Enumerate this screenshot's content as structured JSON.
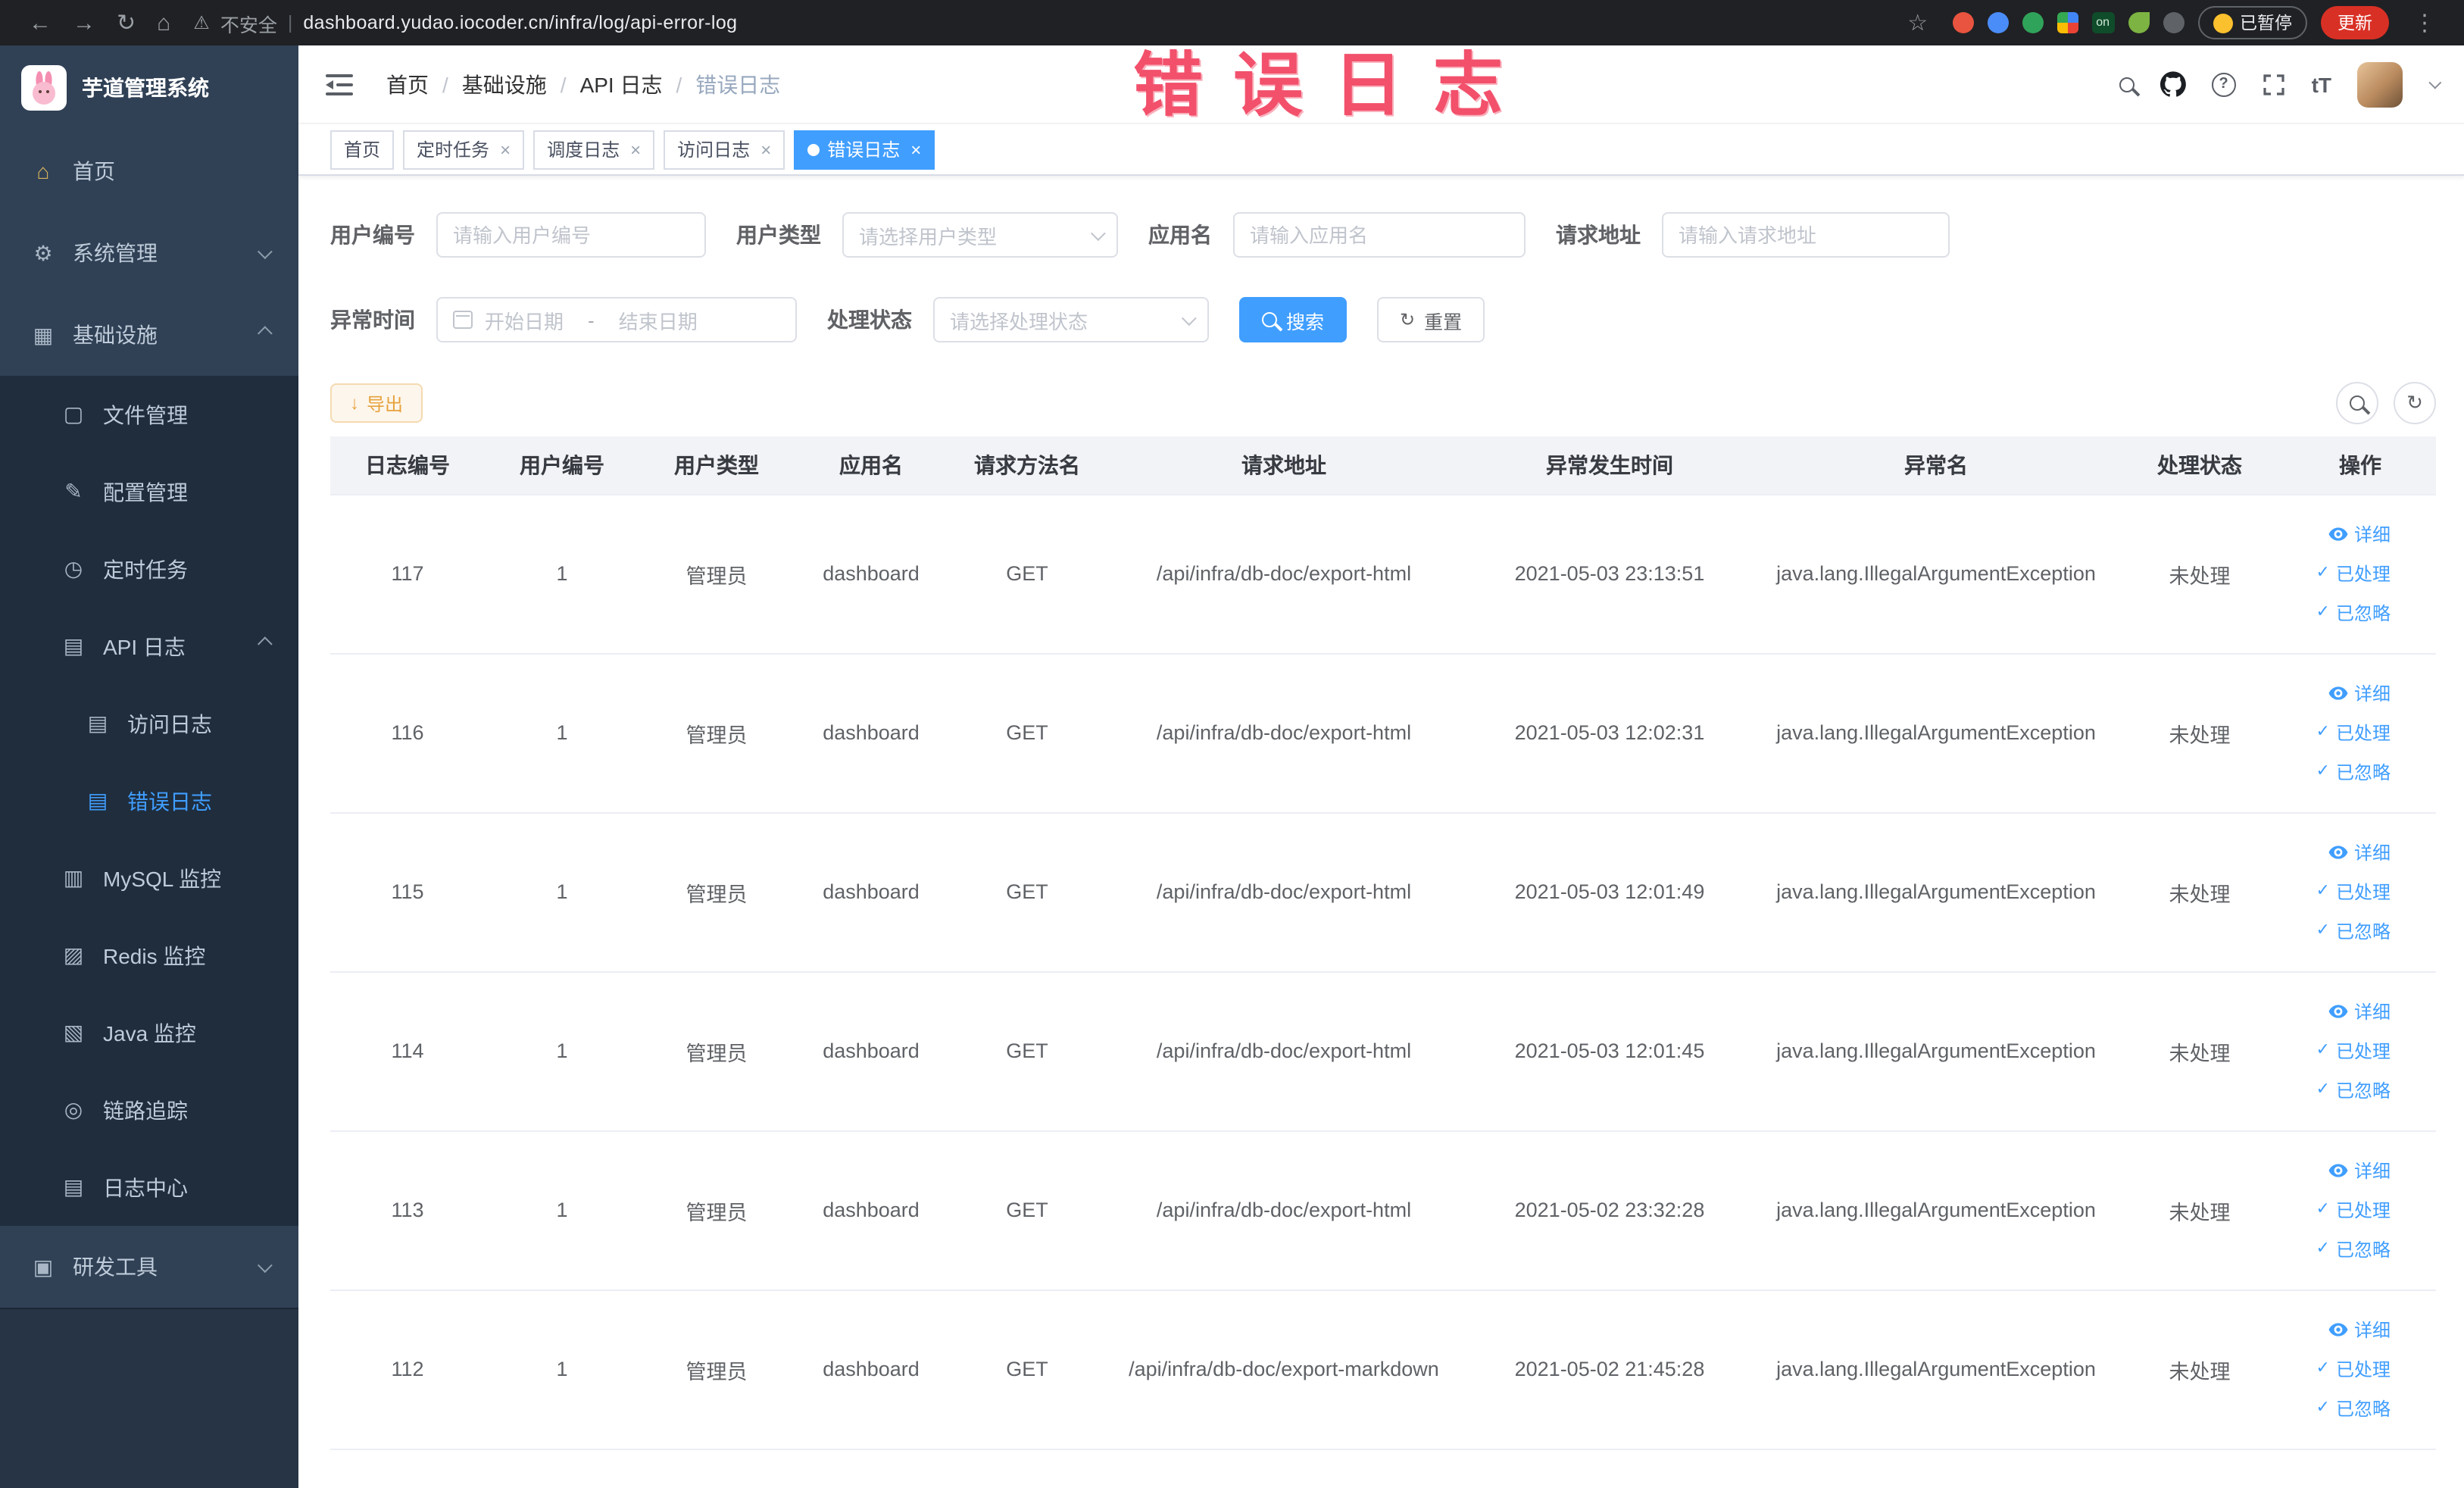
{
  "browser": {
    "security_label": "不安全",
    "url": "dashboard.yudao.iocoder.cn/infra/log/api-error-log",
    "on_badge": "on",
    "paused_badge": "已暂停",
    "update_label": "更新"
  },
  "glyphs": {
    "back": "←",
    "forward": "→",
    "reload": "↻",
    "home": "⌂",
    "warning": "⚠",
    "pipe": "|",
    "star": "☆",
    "kebab": "⋮",
    "menu_home": "⌂",
    "menu_gear": "⚙",
    "menu_infra": "▦",
    "menu_file": "▢",
    "menu_config": "✎",
    "menu_timer": "◷",
    "menu_apilog": "▤",
    "menu_accesslog": "▤",
    "menu_errorlog": "▤",
    "menu_mysql": "▥",
    "menu_redis": "▨",
    "menu_java": "▧",
    "menu_trace": "◎",
    "menu_logcenter": "▤",
    "menu_tools": "▣",
    "check": "✓",
    "download": "↓",
    "refresh": "↻",
    "close": "×",
    "question": "?",
    "font_size": "tT"
  },
  "annotation": {
    "text": "错误日志",
    "color": "#f2506b"
  },
  "sidebar": {
    "logo_title": "芋道管理系统",
    "items": [
      {
        "label": "首页"
      },
      {
        "label": "系统管理"
      },
      {
        "label": "基础设施"
      },
      {
        "label": "文件管理"
      },
      {
        "label": "配置管理"
      },
      {
        "label": "定时任务"
      },
      {
        "label": "API 日志"
      },
      {
        "label": "访问日志"
      },
      {
        "label": "错误日志"
      },
      {
        "label": "MySQL 监控"
      },
      {
        "label": "Redis 监控"
      },
      {
        "label": "Java 监控"
      },
      {
        "label": "链路追踪"
      },
      {
        "label": "日志中心"
      },
      {
        "label": "研发工具"
      }
    ]
  },
  "header": {
    "breadcrumb": [
      "首页",
      "基础设施",
      "API 日志",
      "错误日志"
    ],
    "breadcrumb_sep": "/"
  },
  "tags": [
    {
      "label": "首页"
    },
    {
      "label": "定时任务"
    },
    {
      "label": "调度日志"
    },
    {
      "label": "访问日志"
    },
    {
      "label": "错误日志"
    }
  ],
  "filters": {
    "user_id": {
      "label": "用户编号",
      "placeholder": "请输入用户编号",
      "value": ""
    },
    "user_type": {
      "label": "用户类型",
      "placeholder": "请选择用户类型"
    },
    "app_name": {
      "label": "应用名",
      "placeholder": "请输入应用名",
      "value": ""
    },
    "request_url": {
      "label": "请求地址",
      "placeholder": "请输入请求地址",
      "value": ""
    },
    "exception_time": {
      "label": "异常时间",
      "start_placeholder": "开始日期",
      "separator": "-",
      "end_placeholder": "结束日期"
    },
    "process_status": {
      "label": "处理状态",
      "placeholder": "请选择处理状态"
    },
    "search_button": "搜索",
    "reset_button": "重置"
  },
  "toolbar": {
    "export_button": "导出"
  },
  "table": {
    "columns": [
      "日志编号",
      "用户编号",
      "用户类型",
      "应用名",
      "请求方法名",
      "请求地址",
      "异常发生时间",
      "异常名",
      "处理状态",
      "操作"
    ],
    "ops": [
      "详细",
      "已处理",
      "已忽略"
    ],
    "rows": [
      {
        "id": "117",
        "user_id": "1",
        "user_type": "管理员",
        "app_name": "dashboard",
        "method": "GET",
        "url": "/api/infra/db-doc/export-html",
        "time": "2021-05-03 23:13:51",
        "exception": "java.lang.IllegalArgumentException",
        "status": "未处理"
      },
      {
        "id": "116",
        "user_id": "1",
        "user_type": "管理员",
        "app_name": "dashboard",
        "method": "GET",
        "url": "/api/infra/db-doc/export-html",
        "time": "2021-05-03 12:02:31",
        "exception": "java.lang.IllegalArgumentException",
        "status": "未处理"
      },
      {
        "id": "115",
        "user_id": "1",
        "user_type": "管理员",
        "app_name": "dashboard",
        "method": "GET",
        "url": "/api/infra/db-doc/export-html",
        "time": "2021-05-03 12:01:49",
        "exception": "java.lang.IllegalArgumentException",
        "status": "未处理"
      },
      {
        "id": "114",
        "user_id": "1",
        "user_type": "管理员",
        "app_name": "dashboard",
        "method": "GET",
        "url": "/api/infra/db-doc/export-html",
        "time": "2021-05-03 12:01:45",
        "exception": "java.lang.IllegalArgumentException",
        "status": "未处理"
      },
      {
        "id": "113",
        "user_id": "1",
        "user_type": "管理员",
        "app_name": "dashboard",
        "method": "GET",
        "url": "/api/infra/db-doc/export-html",
        "time": "2021-05-02 23:32:28",
        "exception": "java.lang.IllegalArgumentException",
        "status": "未处理"
      },
      {
        "id": "112",
        "user_id": "1",
        "user_type": "管理员",
        "app_name": "dashboard",
        "method": "GET",
        "url": "/api/infra/db-doc/export-markdown",
        "time": "2021-05-02 21:45:28",
        "exception": "java.lang.IllegalArgumentException",
        "status": "未处理"
      }
    ]
  },
  "colors": {
    "accent": "#409EFF",
    "warning": "#E6A23C",
    "annotation_red": "#F2506B",
    "sidebar_bg": "#304156",
    "sidebar_sub_bg": "#1F2D3D",
    "chrome_bg": "#202124"
  }
}
